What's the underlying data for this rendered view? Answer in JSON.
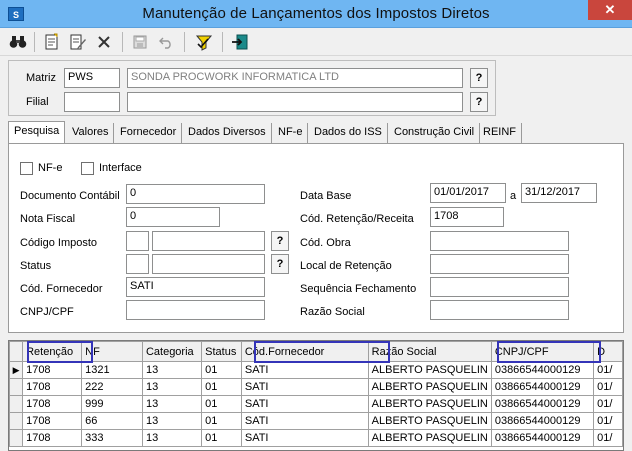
{
  "window": {
    "title": "Manutenção de Lançamentos dos Impostos Diretos",
    "close": "✕"
  },
  "toolbar": {
    "icons": [
      "binoculars-icon",
      "new-document-icon",
      "edit-icon",
      "delete-icon",
      "save-icon",
      "undo-icon",
      "filter-icon",
      "exit-icon"
    ]
  },
  "header": {
    "matriz_label": "Matriz",
    "matriz_code": "PWS",
    "matriz_name": "SONDA PROCWORK INFORMATICA LTD",
    "filial_label": "Filial",
    "filial_code": "",
    "filial_name": "",
    "lookup": "?"
  },
  "tabs": [
    "Pesquisa",
    "Valores",
    "Fornecedor",
    "Dados Diversos",
    "NF-e",
    "Dados do ISS",
    "Construção Civil",
    "REINF"
  ],
  "search": {
    "nfe_label": "NF-e",
    "interface_label": "Interface",
    "documento_contabil_label": "Documento Contábil",
    "documento_contabil": "0",
    "nota_fiscal_label": "Nota Fiscal",
    "nota_fiscal": "0",
    "codigo_imposto_label": "Código Imposto",
    "status_label": "Status",
    "cod_fornecedor_label": "Cód. Fornecedor",
    "cod_fornecedor": "SATI",
    "cnpj_label": "CNPJ/CPF",
    "data_base_label": "Data Base",
    "data_base_from": "01/01/2017",
    "data_base_sep": "a",
    "data_base_to": "31/12/2017",
    "cod_retencao_label": "Cód. Retenção/Receita",
    "cod_retencao": "1708",
    "cod_obra_label": "Cód. Obra",
    "local_retencao_label": "Local de Retenção",
    "sequencia_label": "Sequência Fechamento",
    "razao_social_label": "Razão Social",
    "lookup": "?"
  },
  "grid": {
    "columns": [
      "Retenção",
      "NF",
      "Categoria",
      "Status",
      "Cód.Fornecedor",
      "Razão Social",
      "CNPJ/CPF",
      "D"
    ],
    "rows": [
      [
        "1708",
        "1321",
        "13",
        "01",
        "SATI",
        "ALBERTO PASQUELIN",
        "03866544000129",
        "01/"
      ],
      [
        "1708",
        "222",
        "13",
        "01",
        "SATI",
        "ALBERTO PASQUELIN",
        "03866544000129",
        "01/"
      ],
      [
        "1708",
        "999",
        "13",
        "01",
        "SATI",
        "ALBERTO PASQUELIN",
        "03866544000129",
        "01/"
      ],
      [
        "1708",
        "66",
        "13",
        "01",
        "SATI",
        "ALBERTO PASQUELIN",
        "03866544000129",
        "01/"
      ],
      [
        "1708",
        "333",
        "13",
        "01",
        "SATI",
        "ALBERTO PASQUELIN",
        "03866544000129",
        "01/"
      ]
    ],
    "current_row_marker": "▶"
  },
  "colors": {
    "titlebar": "#6fb6f2",
    "highlight_box": "#3434b8",
    "close_button": "#c9463d"
  }
}
